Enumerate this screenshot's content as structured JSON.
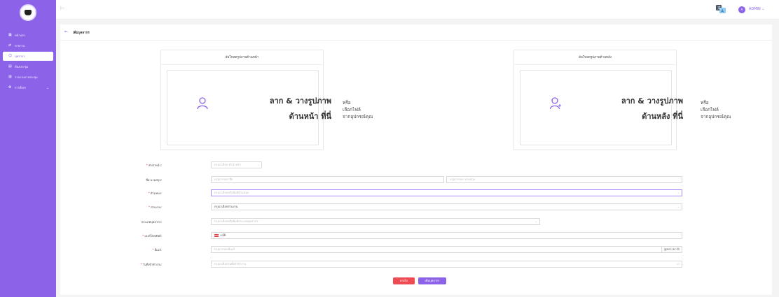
{
  "sidebar": {
    "items": [
      {
        "label": "หน้าแรก",
        "icon": "grid-icon"
      },
      {
        "label": "ทายกาม",
        "icon": "swap-icon"
      },
      {
        "label": "บุคลากร",
        "icon": "people-icon"
      },
      {
        "label": "ห้องประชุม",
        "icon": "list-icon"
      },
      {
        "label": "รายงานการประชุม",
        "icon": "table-icon"
      },
      {
        "label": "การตั้งค่า",
        "icon": "gear-icon"
      }
    ]
  },
  "topbar": {
    "admin_label": "ADMIN",
    "avatar_initial": "A"
  },
  "page": {
    "back_icon": "←",
    "title": "เพิ่มบุคลากร"
  },
  "upload": {
    "front": {
      "title": "อัพโหลดรูปภาพด้านหน้า",
      "drop_line1": "ลาก & วางรูปภาพ",
      "drop_line2": "ด้านหน้า ที่นี่",
      "or_line1": "หรือ",
      "or_line2": "เลือกไฟล์",
      "or_line3": "จากอุปกรณ์คุณ"
    },
    "back": {
      "title": "อัพโหลดรูปภาพด้านหลัง",
      "drop_line1": "ลาก & วางรูปภาพ",
      "drop_line2": "ด้านหลัง ที่นี่",
      "or_line1": "หรือ",
      "or_line2": "เลือกไฟล์",
      "or_line3": "จากอุปกรณ์คุณ"
    }
  },
  "form": {
    "prefix": {
      "label": "คำนำหน้า:",
      "placeholder": "กรุณาเลือก คำนำหน้า"
    },
    "name": {
      "label": "ชื่อ-นามสกุล:",
      "first_placeholder": "กรุณากรอก ชื่อ",
      "last_placeholder": "กรุณากรอก นามสกุล"
    },
    "position": {
      "label": "ตำแหน่ง:",
      "placeholder": "กรุณาเลือกหรือพิมพ์ตำแหน่ง"
    },
    "department": {
      "label": "ส่วนงาน:",
      "value": "กรุณาเลือกส่วนงาน"
    },
    "personnel_type": {
      "label": "ประเภทบุคลากร:",
      "placeholder": "กรุณาเลือกหรือพิมพ์ประเภทบุคลากร"
    },
    "phone": {
      "label": "เบอร์โทรศัพท์:",
      "code": "+66"
    },
    "email": {
      "label": "อีเมล์:",
      "placeholder": "กรุณากรอกอีเมล์",
      "suffix": "@ecc.ac.th"
    },
    "start_date": {
      "label": "วันที่เข้าทำงาน:",
      "placeholder": "กรุณาเลือกวันที่เข้าทำงาน"
    }
  },
  "buttons": {
    "cancel": "ยกเลิก",
    "add": "เพิ่มบุคลากร"
  },
  "colors": {
    "accent": "#8c63e8",
    "danger": "#ef4b55"
  }
}
